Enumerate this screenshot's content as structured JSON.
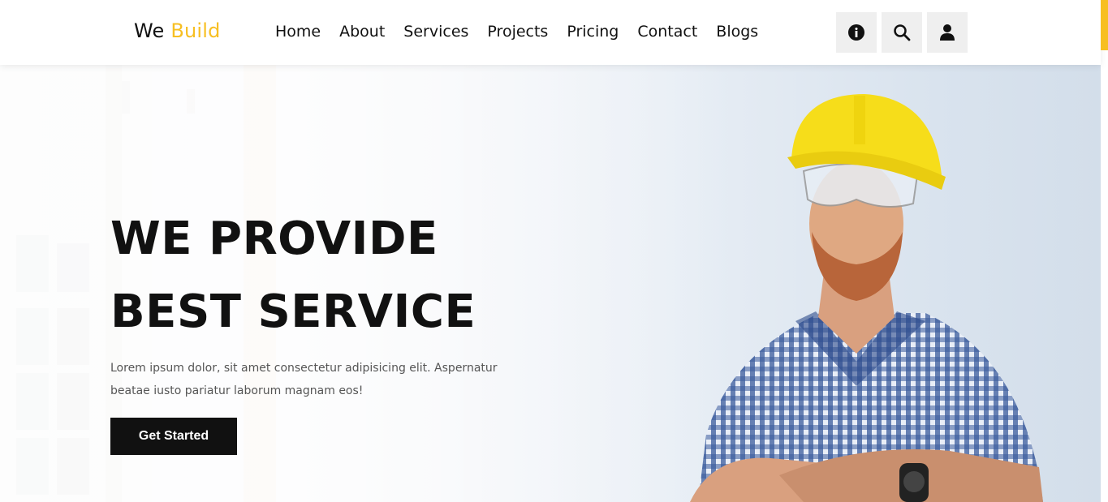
{
  "header": {
    "logo_part1": "We",
    "logo_part2": "Build",
    "nav": [
      "Home",
      "About",
      "Services",
      "Projects",
      "Pricing",
      "Contact",
      "Blogs"
    ],
    "icons": [
      "info-icon",
      "search-icon",
      "user-icon"
    ]
  },
  "hero": {
    "title_line1": "WE PROVIDE",
    "title_line2": "BEST SERVICE",
    "text": "Lorem ipsum dolor, sit amet consectetur adipisicing elit. Aspernatur beatae iusto pariatur laborum magnam eos!",
    "cta_label": "Get Started"
  },
  "colors": {
    "accent": "#f7bf22",
    "dark": "#111111",
    "icon_bg": "#efefef"
  }
}
